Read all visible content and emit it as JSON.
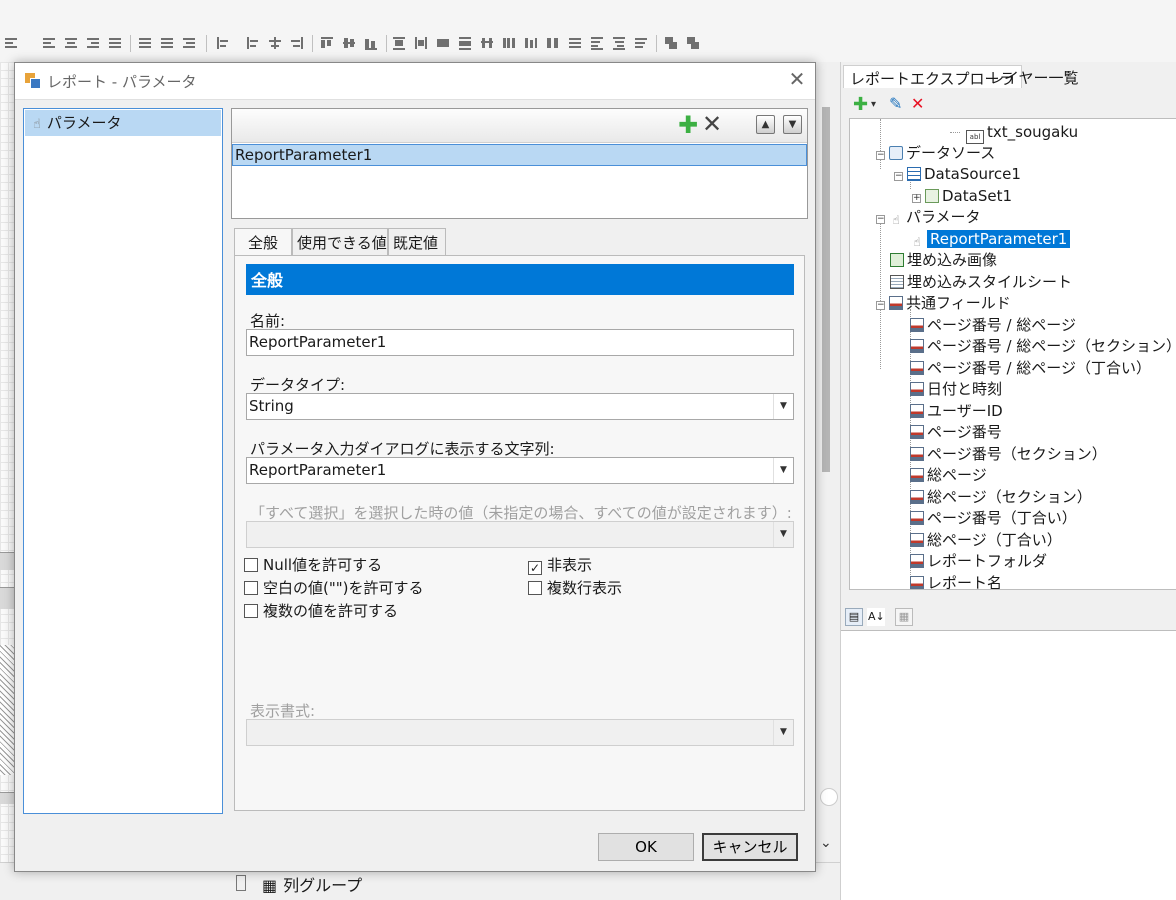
{
  "dialog": {
    "title": "レポート - パラメータ",
    "close_glyph": "✕",
    "left_item": "パラメータ",
    "param_list": [
      "ReportParameter1"
    ],
    "tabs": [
      {
        "label": "全般",
        "active": true
      },
      {
        "label": "使用できる値",
        "active": false
      },
      {
        "label": "既定値",
        "active": false
      }
    ],
    "section_header": "全般",
    "fields": {
      "name_label": "名前:",
      "name_value": "ReportParameter1",
      "datatype_label": "データタイプ:",
      "datatype_value": "String",
      "prompt_label": "パラメータ入力ダイアログに表示する文字列:",
      "prompt_value": "ReportParameter1",
      "selectall_label": "「すべて選択」を選択した時の値（未指定の場合、すべての値が設定されます）:",
      "selectall_value": "",
      "format_label": "表示書式:",
      "format_value": ""
    },
    "checkboxes": {
      "allow_null": {
        "label": "Null値を許可する",
        "checked": false
      },
      "allow_blank": {
        "label": "空白の値(\"\")を許可する",
        "checked": false
      },
      "multi_value": {
        "label": "複数の値を許可する",
        "checked": false
      },
      "hidden": {
        "label": "非表示",
        "checked": true
      },
      "multiline": {
        "label": "複数行表示",
        "checked": false
      }
    },
    "ok_label": "OK",
    "cancel_label": "キャンセル"
  },
  "explorer": {
    "tabs": [
      "レポートエクスプローラ",
      "レイヤー一覧"
    ],
    "tree": [
      {
        "label": "txt_sougaku",
        "icon": "textbox-icon"
      },
      {
        "label": "データソース",
        "icon": "datasource-icon"
      },
      {
        "label": "DataSource1",
        "icon": "table-icon"
      },
      {
        "label": "DataSet1",
        "icon": "dataset-icon"
      },
      {
        "label": "パラメータ",
        "icon": "parameter-icon"
      },
      {
        "label": "ReportParameter1",
        "icon": "parameter-icon",
        "selected": true
      },
      {
        "label": "埋め込み画像",
        "icon": "image-icon"
      },
      {
        "label": "埋め込みスタイルシート",
        "icon": "stylesheet-icon"
      },
      {
        "label": "共通フィールド",
        "icon": "field-icon"
      },
      {
        "label": "ページ番号 / 総ページ",
        "icon": "field-icon"
      },
      {
        "label": "ページ番号 / 総ページ（セクション）",
        "icon": "field-icon"
      },
      {
        "label": "ページ番号 / 総ページ（丁合い）",
        "icon": "field-icon"
      },
      {
        "label": "日付と時刻",
        "icon": "field-icon"
      },
      {
        "label": "ユーザーID",
        "icon": "field-icon"
      },
      {
        "label": "ページ番号",
        "icon": "field-icon"
      },
      {
        "label": "ページ番号（セクション）",
        "icon": "field-icon"
      },
      {
        "label": "総ページ",
        "icon": "field-icon"
      },
      {
        "label": "総ページ（セクション）",
        "icon": "field-icon"
      },
      {
        "label": "ページ番号（丁合い）",
        "icon": "field-icon"
      },
      {
        "label": "総ページ（丁合い）",
        "icon": "field-icon"
      },
      {
        "label": "レポートフォルダ",
        "icon": "field-icon"
      },
      {
        "label": "レポート名",
        "icon": "field-icon"
      }
    ]
  },
  "designer": {
    "column_group_label": "列グループ"
  },
  "colors": {
    "accent": "#0078d7",
    "selection": "#b9d8f3",
    "add_green": "#3cb043",
    "delete_red": "#e81123"
  }
}
